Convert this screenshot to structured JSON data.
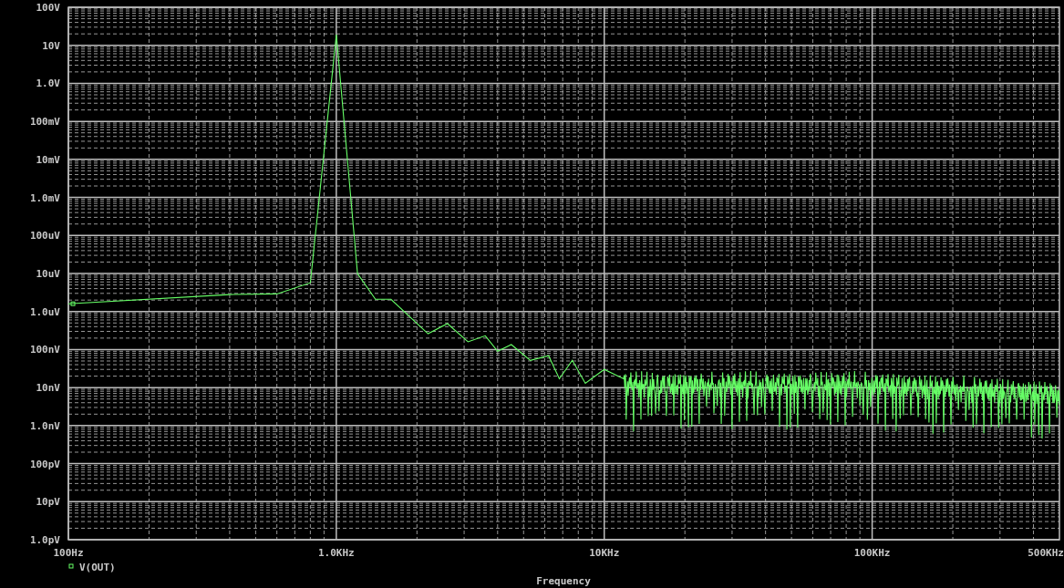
{
  "plot": {
    "y_labels": [
      "100V",
      "10V",
      "1.0V",
      "100mV",
      "10mV",
      "1.0mV",
      "100uV",
      "10uV",
      "1.0uV",
      "100nV",
      "10nV",
      "1.0nV",
      "100pV",
      "10pV",
      "1.0pV"
    ],
    "x_labels": [
      "100Hz",
      "1.0KHz",
      "10KHz",
      "100KHz",
      "500KHz"
    ],
    "legend": [
      "V(OUT)"
    ],
    "x_title": "Frequency"
  }
}
